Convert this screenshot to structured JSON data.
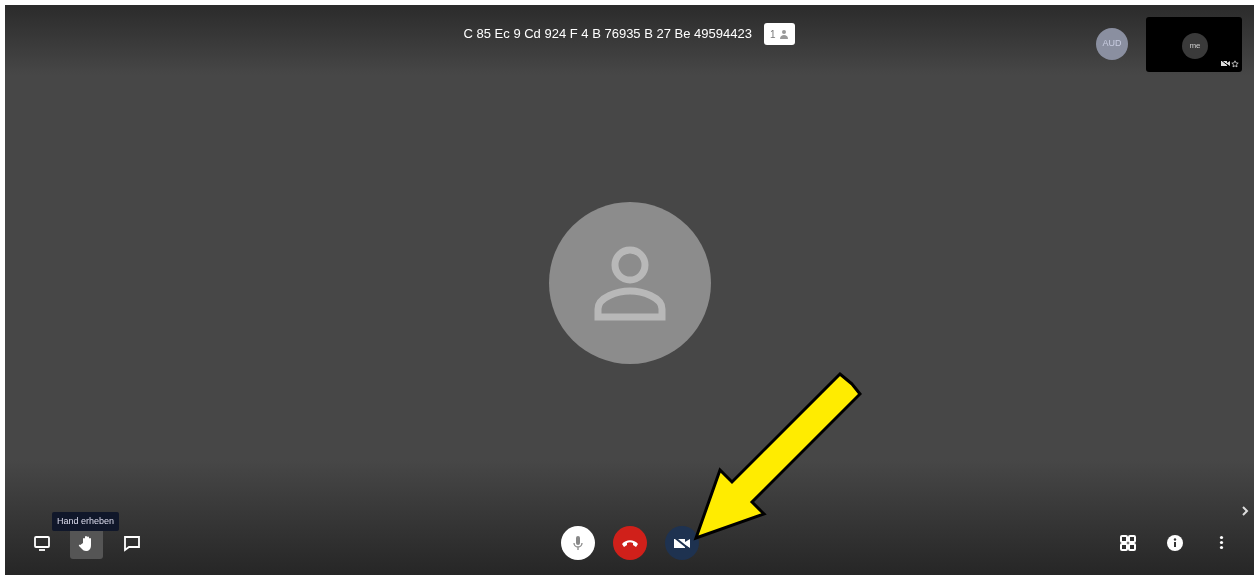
{
  "meeting": {
    "title": "C 85 Ec 9 Cd 924 F 4 B 76935 B 27 Be 49594423",
    "participant_count": "1"
  },
  "participants": [
    {
      "initials": "AUD"
    }
  ],
  "self_view": {
    "label": "me",
    "camera_off": true
  },
  "toolbar_left": [
    {
      "kind": "screen",
      "selected": false
    },
    {
      "kind": "hand",
      "selected": true
    },
    {
      "kind": "chat",
      "selected": false
    }
  ],
  "tooltip": "Hand erheben",
  "call_controls": [
    {
      "kind": "mic",
      "muted": false
    },
    {
      "kind": "hangup"
    },
    {
      "kind": "camera",
      "muted": true
    }
  ],
  "toolbar_right": [
    {
      "kind": "tiles"
    },
    {
      "kind": "info"
    },
    {
      "kind": "more"
    }
  ],
  "annotation": {
    "kind": "arrow"
  }
}
